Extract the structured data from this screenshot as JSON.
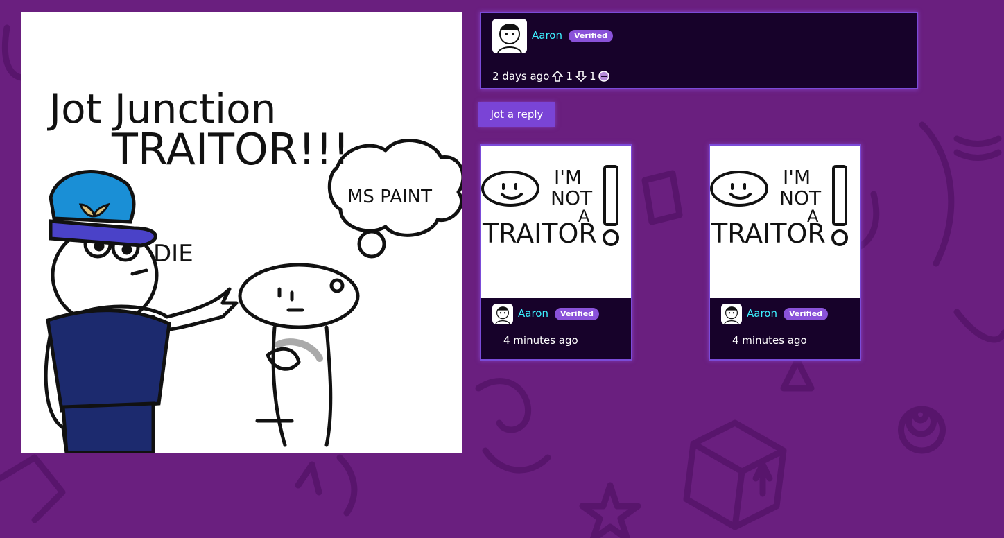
{
  "colors": {
    "background": "#6a1f7f",
    "card": "#17022a",
    "accent": "#7b4bd8",
    "username": "#3df0ff",
    "badge": "#8a52d9"
  },
  "main_drawing": {
    "title_line1": "Jot Junction",
    "title_line2": "TRAITOR!!!",
    "bubble_text": "MS PAINT",
    "speech_text": "DIE"
  },
  "post": {
    "username": "Aaron",
    "badge": "Verified",
    "time": "2 days ago",
    "upvotes": "1",
    "downvotes": "1"
  },
  "reply_button": "Jot a reply",
  "replies": [
    {
      "drawing_text_1": "I'M",
      "drawing_text_2": "NOT",
      "drawing_text_3": "A",
      "drawing_text_4": "TRAITOR",
      "username": "Aaron",
      "badge": "Verified",
      "time": "4 minutes ago"
    },
    {
      "drawing_text_1": "I'M",
      "drawing_text_2": "NOT",
      "drawing_text_3": "A",
      "drawing_text_4": "TRAITOR",
      "username": "Aaron",
      "badge": "Verified",
      "time": "4 minutes ago"
    }
  ]
}
